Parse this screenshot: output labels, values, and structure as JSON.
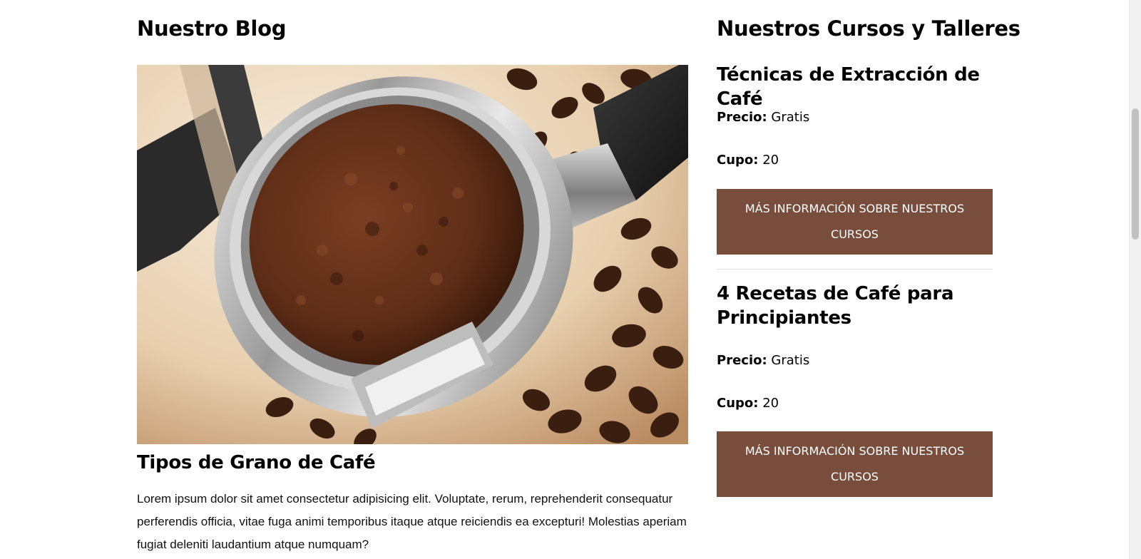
{
  "blog": {
    "heading": "Nuestro Blog",
    "image_description_icon": "coffee-portafilter-image",
    "post": {
      "title": "Tipos de Grano de Café",
      "excerpt": "Lorem ipsum dolor sit amet consectetur adipisicing elit. Voluptate, rerum, reprehenderit consequatur perferendis officia, vitae fuga animi temporibus itaque atque reiciendis ea excepturi! Molestias aperiam fugiat deleniti laudantium atque numquam?"
    }
  },
  "courses": {
    "heading": "Nuestros Cursos y Talleres",
    "items": [
      {
        "title": "Técnicas de Extracción de Café",
        "price_label": "Precio:",
        "price_value": "Gratis",
        "seats_label": "Cupo:",
        "seats_value": "20",
        "button_label": "MÁS INFORMACIÓN SOBRE NUESTROS CURSOS"
      },
      {
        "title": "4 Recetas de Café para Principiantes",
        "price_label": "Precio:",
        "price_value": "Gratis",
        "seats_label": "Cupo:",
        "seats_value": "20",
        "button_label": "MÁS INFORMACIÓN SOBRE NUESTROS CURSOS"
      }
    ]
  },
  "colors": {
    "button_bg": "#784d3c",
    "button_text": "#ffffff",
    "text": "#000000"
  }
}
